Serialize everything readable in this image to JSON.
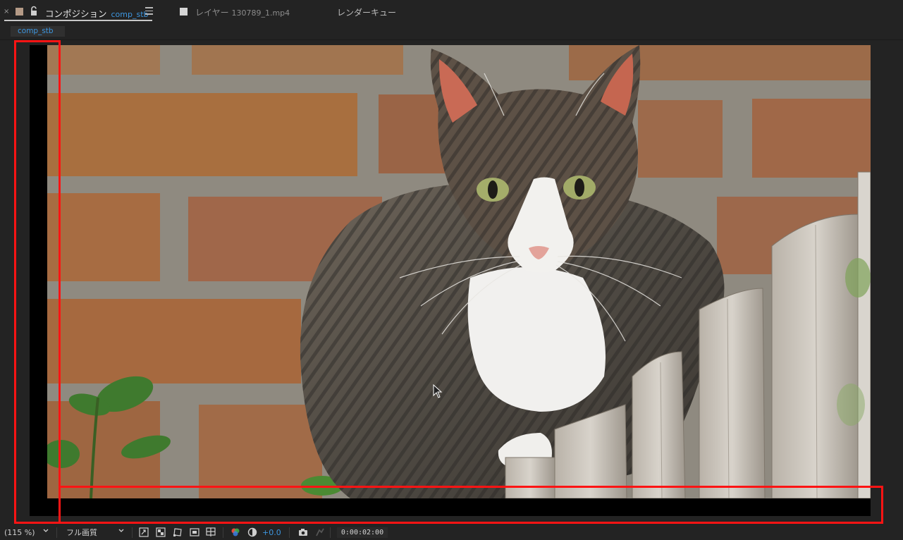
{
  "tabs": {
    "composition": {
      "close_glyph": "×",
      "label": "コンポジション",
      "name": "comp_stb"
    },
    "layer": {
      "label": "レイヤー",
      "name": "130789_1.mp4"
    },
    "render_queue": {
      "label": "レンダーキュー"
    }
  },
  "breadcrumb": {
    "label": "comp_stb"
  },
  "toolbar": {
    "zoom": "(115 %)",
    "resolution": "フル画質",
    "exposure": "+0.0",
    "timecode": "0:00:02:00"
  },
  "colors": {
    "panel_bg": "#232323",
    "accent_blue": "#3d96df",
    "highlight_red": "#ff1414"
  },
  "icons": [
    "close-icon",
    "label-color-swatch",
    "lock-icon",
    "panel-menu-icon",
    "footage-swatch",
    "region-of-interest-icon",
    "transparency-grid-icon",
    "mask-path-visibility-icon",
    "safe-margins-icon",
    "grid-guides-icon",
    "color-channels-icon",
    "reset-exposure-icon",
    "snapshot-icon",
    "show-snapshot-icon"
  ]
}
